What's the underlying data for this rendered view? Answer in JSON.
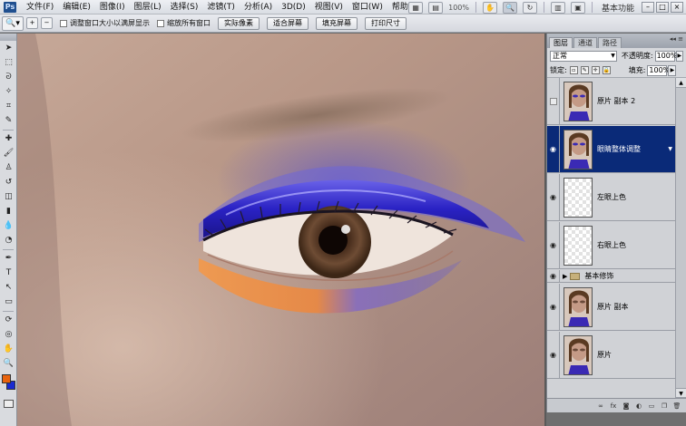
{
  "app": {
    "logo": "Ps",
    "workspace": "基本功能"
  },
  "menu": [
    "文件(F)",
    "编辑(E)",
    "图像(I)",
    "图层(L)",
    "选择(S)",
    "滤镜(T)",
    "分析(A)",
    "3D(D)",
    "视图(V)",
    "窗口(W)",
    "帮助(H)"
  ],
  "menubar_right": {
    "zoom": "100%"
  },
  "options": {
    "checkbox1": "调整窗口大小以满屏显示",
    "checkbox2": "缩放所有窗口",
    "buttons": [
      "实际像素",
      "适合屏幕",
      "填充屏幕",
      "打印尺寸"
    ]
  },
  "colors": {
    "foreground": "#e8630e",
    "background": "#1a2bd0"
  },
  "layers_panel": {
    "tabs": [
      "图层",
      "通道",
      "路径"
    ],
    "blend_mode": "正常",
    "opacity_label": "不透明度:",
    "opacity": "100%",
    "lock_label": "锁定:",
    "fill_label": "填充:",
    "fill": "100%",
    "layers": [
      {
        "name": "原片 副本 2",
        "visible": false,
        "thumb": "photo"
      },
      {
        "name": "眼睛整体调整",
        "visible": true,
        "thumb": "photo",
        "selected": true
      },
      {
        "name": "左眼上色",
        "visible": true,
        "thumb": "empty"
      },
      {
        "name": "右眼上色",
        "visible": true,
        "thumb": "empty"
      },
      {
        "name": "基本修饰",
        "visible": true,
        "type": "group"
      },
      {
        "name": "原片 副本",
        "visible": true,
        "thumb": "photo"
      },
      {
        "name": "原片",
        "visible": true,
        "thumb": "photo"
      }
    ]
  }
}
